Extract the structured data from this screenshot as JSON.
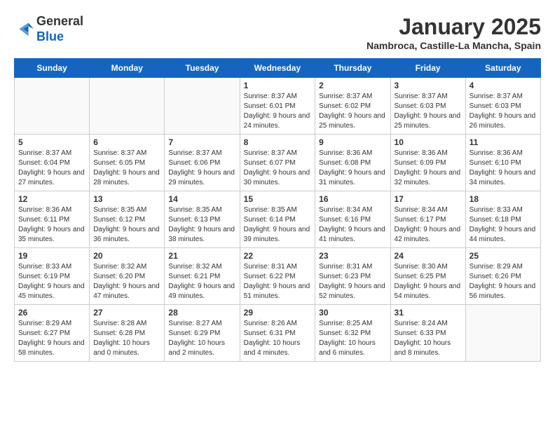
{
  "header": {
    "logo_line1": "General",
    "logo_line2": "Blue",
    "month_title": "January 2025",
    "subtitle": "Nambroca, Castille-La Mancha, Spain"
  },
  "weekdays": [
    "Sunday",
    "Monday",
    "Tuesday",
    "Wednesday",
    "Thursday",
    "Friday",
    "Saturday"
  ],
  "weeks": [
    [
      {
        "day": "",
        "info": ""
      },
      {
        "day": "",
        "info": ""
      },
      {
        "day": "",
        "info": ""
      },
      {
        "day": "1",
        "info": "Sunrise: 8:37 AM\nSunset: 6:01 PM\nDaylight: 9 hours\nand 24 minutes."
      },
      {
        "day": "2",
        "info": "Sunrise: 8:37 AM\nSunset: 6:02 PM\nDaylight: 9 hours\nand 25 minutes."
      },
      {
        "day": "3",
        "info": "Sunrise: 8:37 AM\nSunset: 6:03 PM\nDaylight: 9 hours\nand 25 minutes."
      },
      {
        "day": "4",
        "info": "Sunrise: 8:37 AM\nSunset: 6:03 PM\nDaylight: 9 hours\nand 26 minutes."
      }
    ],
    [
      {
        "day": "5",
        "info": "Sunrise: 8:37 AM\nSunset: 6:04 PM\nDaylight: 9 hours\nand 27 minutes."
      },
      {
        "day": "6",
        "info": "Sunrise: 8:37 AM\nSunset: 6:05 PM\nDaylight: 9 hours\nand 28 minutes."
      },
      {
        "day": "7",
        "info": "Sunrise: 8:37 AM\nSunset: 6:06 PM\nDaylight: 9 hours\nand 29 minutes."
      },
      {
        "day": "8",
        "info": "Sunrise: 8:37 AM\nSunset: 6:07 PM\nDaylight: 9 hours\nand 30 minutes."
      },
      {
        "day": "9",
        "info": "Sunrise: 8:36 AM\nSunset: 6:08 PM\nDaylight: 9 hours\nand 31 minutes."
      },
      {
        "day": "10",
        "info": "Sunrise: 8:36 AM\nSunset: 6:09 PM\nDaylight: 9 hours\nand 32 minutes."
      },
      {
        "day": "11",
        "info": "Sunrise: 8:36 AM\nSunset: 6:10 PM\nDaylight: 9 hours\nand 34 minutes."
      }
    ],
    [
      {
        "day": "12",
        "info": "Sunrise: 8:36 AM\nSunset: 6:11 PM\nDaylight: 9 hours\nand 35 minutes."
      },
      {
        "day": "13",
        "info": "Sunrise: 8:35 AM\nSunset: 6:12 PM\nDaylight: 9 hours\nand 36 minutes."
      },
      {
        "day": "14",
        "info": "Sunrise: 8:35 AM\nSunset: 6:13 PM\nDaylight: 9 hours\nand 38 minutes."
      },
      {
        "day": "15",
        "info": "Sunrise: 8:35 AM\nSunset: 6:14 PM\nDaylight: 9 hours\nand 39 minutes."
      },
      {
        "day": "16",
        "info": "Sunrise: 8:34 AM\nSunset: 6:16 PM\nDaylight: 9 hours\nand 41 minutes."
      },
      {
        "day": "17",
        "info": "Sunrise: 8:34 AM\nSunset: 6:17 PM\nDaylight: 9 hours\nand 42 minutes."
      },
      {
        "day": "18",
        "info": "Sunrise: 8:33 AM\nSunset: 6:18 PM\nDaylight: 9 hours\nand 44 minutes."
      }
    ],
    [
      {
        "day": "19",
        "info": "Sunrise: 8:33 AM\nSunset: 6:19 PM\nDaylight: 9 hours\nand 45 minutes."
      },
      {
        "day": "20",
        "info": "Sunrise: 8:32 AM\nSunset: 6:20 PM\nDaylight: 9 hours\nand 47 minutes."
      },
      {
        "day": "21",
        "info": "Sunrise: 8:32 AM\nSunset: 6:21 PM\nDaylight: 9 hours\nand 49 minutes."
      },
      {
        "day": "22",
        "info": "Sunrise: 8:31 AM\nSunset: 6:22 PM\nDaylight: 9 hours\nand 51 minutes."
      },
      {
        "day": "23",
        "info": "Sunrise: 8:31 AM\nSunset: 6:23 PM\nDaylight: 9 hours\nand 52 minutes."
      },
      {
        "day": "24",
        "info": "Sunrise: 8:30 AM\nSunset: 6:25 PM\nDaylight: 9 hours\nand 54 minutes."
      },
      {
        "day": "25",
        "info": "Sunrise: 8:29 AM\nSunset: 6:26 PM\nDaylight: 9 hours\nand 56 minutes."
      }
    ],
    [
      {
        "day": "26",
        "info": "Sunrise: 8:29 AM\nSunset: 6:27 PM\nDaylight: 9 hours\nand 58 minutes."
      },
      {
        "day": "27",
        "info": "Sunrise: 8:28 AM\nSunset: 6:28 PM\nDaylight: 10 hours\nand 0 minutes."
      },
      {
        "day": "28",
        "info": "Sunrise: 8:27 AM\nSunset: 6:29 PM\nDaylight: 10 hours\nand 2 minutes."
      },
      {
        "day": "29",
        "info": "Sunrise: 8:26 AM\nSunset: 6:31 PM\nDaylight: 10 hours\nand 4 minutes."
      },
      {
        "day": "30",
        "info": "Sunrise: 8:25 AM\nSunset: 6:32 PM\nDaylight: 10 hours\nand 6 minutes."
      },
      {
        "day": "31",
        "info": "Sunrise: 8:24 AM\nSunset: 6:33 PM\nDaylight: 10 hours\nand 8 minutes."
      },
      {
        "day": "",
        "info": ""
      }
    ]
  ]
}
